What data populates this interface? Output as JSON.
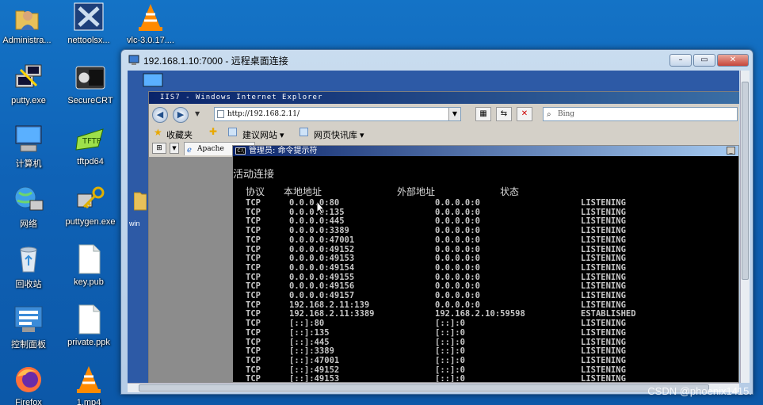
{
  "desktop": {
    "icons": [
      {
        "label": "Administra...",
        "icon": "user-folder-icon"
      },
      {
        "label": "nettoolsx...",
        "icon": "nettools-icon"
      },
      {
        "label": "vlc-3.0.17....",
        "icon": "vlc-cone-icon"
      },
      {
        "label": "putty.exe",
        "icon": "putty-icon"
      },
      {
        "label": "SecureCRT",
        "icon": "securecrt-icon"
      },
      {
        "label": "计算机",
        "icon": "computer-icon"
      },
      {
        "label": "tftpd64",
        "icon": "tftpd64-icon"
      },
      {
        "label": "网络",
        "icon": "network-icon"
      },
      {
        "label": "puttygen.exe",
        "icon": "puttygen-icon"
      },
      {
        "label": "回收站",
        "icon": "recycle-bin-icon"
      },
      {
        "label": "key.pub",
        "icon": "document-icon"
      },
      {
        "label": "控制面板",
        "icon": "control-panel-icon"
      },
      {
        "label": "private.ppk",
        "icon": "document-icon"
      },
      {
        "label": "Firefox",
        "icon": "firefox-icon"
      },
      {
        "label": "1.mp4",
        "icon": "vlc-cone-icon"
      }
    ]
  },
  "rdp_window": {
    "title": "192.168.1.10:7000 - 远程桌面连接",
    "buttons": {
      "minimize": "–",
      "restore": "▭",
      "close": "✕"
    }
  },
  "remote": {
    "desktop_partial_label": "win",
    "ie": {
      "title": "IIS7 - Windows Internet Explorer",
      "address": "http://192.168.2.11/",
      "search_placeholder": "Bing",
      "favorites_label": "收藏夹",
      "fav_links": [
        "建议网站 ▾",
        "网页快讯库 ▾"
      ],
      "tab_label": "Apache"
    },
    "cmd": {
      "title": "管理员: 命令提示符",
      "heading": "活动连接",
      "columns": [
        "协议",
        "本地地址",
        "外部地址",
        "状态"
      ],
      "rows": [
        [
          "TCP",
          "0.0.0.0:80",
          "0.0.0.0:0",
          "LISTENING"
        ],
        [
          "TCP",
          "0.0.0.0:135",
          "0.0.0.0:0",
          "LISTENING"
        ],
        [
          "TCP",
          "0.0.0.0:445",
          "0.0.0.0:0",
          "LISTENING"
        ],
        [
          "TCP",
          "0.0.0.0:3389",
          "0.0.0.0:0",
          "LISTENING"
        ],
        [
          "TCP",
          "0.0.0.0:47001",
          "0.0.0.0:0",
          "LISTENING"
        ],
        [
          "TCP",
          "0.0.0.0:49152",
          "0.0.0.0:0",
          "LISTENING"
        ],
        [
          "TCP",
          "0.0.0.0:49153",
          "0.0.0.0:0",
          "LISTENING"
        ],
        [
          "TCP",
          "0.0.0.0:49154",
          "0.0.0.0:0",
          "LISTENING"
        ],
        [
          "TCP",
          "0.0.0.0:49155",
          "0.0.0.0:0",
          "LISTENING"
        ],
        [
          "TCP",
          "0.0.0.0:49156",
          "0.0.0.0:0",
          "LISTENING"
        ],
        [
          "TCP",
          "0.0.0.0:49157",
          "0.0.0.0:0",
          "LISTENING"
        ],
        [
          "TCP",
          "192.168.2.11:139",
          "0.0.0.0:0",
          "LISTENING"
        ],
        [
          "TCP",
          "192.168.2.11:3389",
          "192.168.2.10:59598",
          "ESTABLISHED"
        ],
        [
          "TCP",
          "[::]:80",
          "[::]:0",
          "LISTENING"
        ],
        [
          "TCP",
          "[::]:135",
          "[::]:0",
          "LISTENING"
        ],
        [
          "TCP",
          "[::]:445",
          "[::]:0",
          "LISTENING"
        ],
        [
          "TCP",
          "[::]:3389",
          "[::]:0",
          "LISTENING"
        ],
        [
          "TCP",
          "[::]:47001",
          "[::]:0",
          "LISTENING"
        ],
        [
          "TCP",
          "[::]:49152",
          "[::]:0",
          "LISTENING"
        ],
        [
          "TCP",
          "[::]:49153",
          "[::]:0",
          "LISTENING"
        ]
      ]
    }
  },
  "watermark": "CSDN @phoenix1415."
}
